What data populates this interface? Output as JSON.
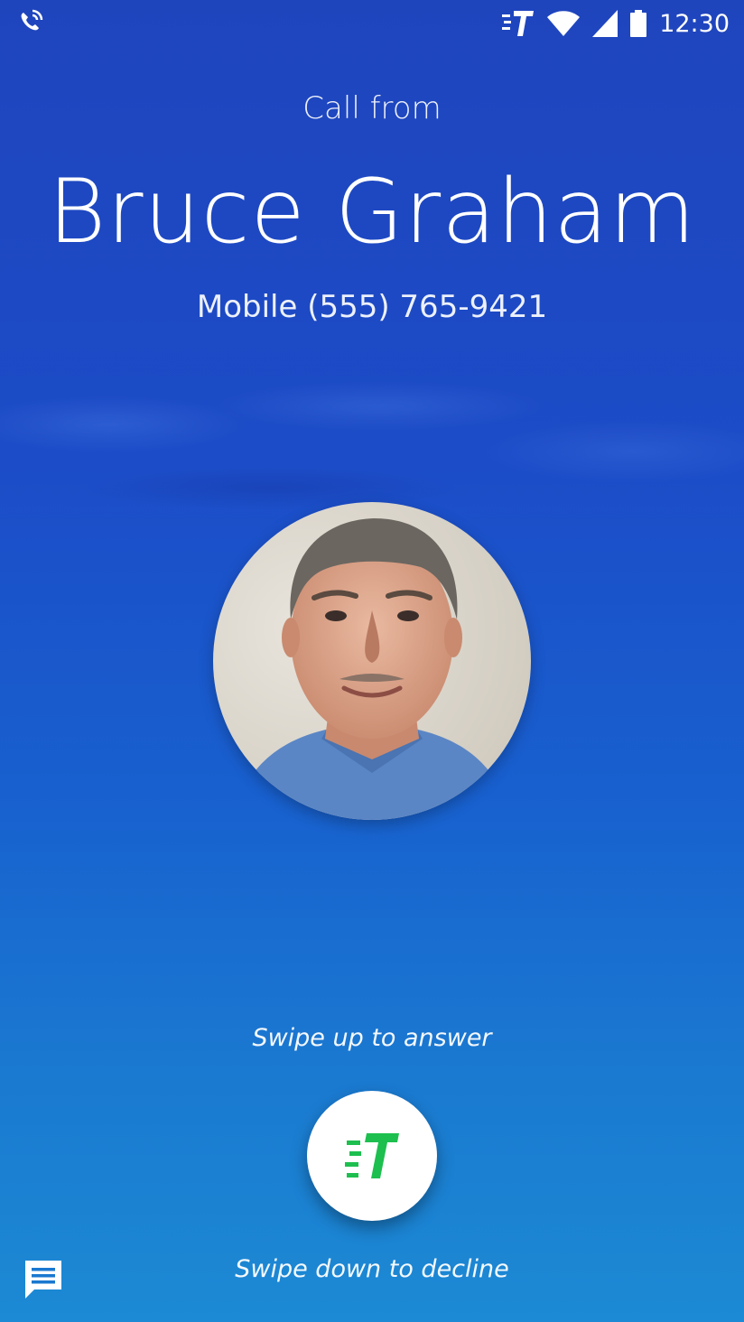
{
  "status_bar": {
    "time": "12:30",
    "left_icon": "wifi-calling-icon",
    "icons": [
      "carrier-t-icon",
      "wifi-icon",
      "cell-signal-icon",
      "battery-icon"
    ]
  },
  "call": {
    "header": "Call from",
    "caller_name": "Bruce Graham",
    "number_line": "Mobile  (555) 765-9421"
  },
  "avatar": {
    "icon": "caller-photo"
  },
  "actions": {
    "answer_hint": "Swipe up to answer",
    "decline_hint": "Swipe down to decline",
    "answer_icon": "carrier-t-icon",
    "message_icon": "message-icon"
  },
  "colors": {
    "accent_green": "#1dbf4f",
    "background_top": "#1f45bd",
    "background_bottom": "#1c8ad4"
  }
}
